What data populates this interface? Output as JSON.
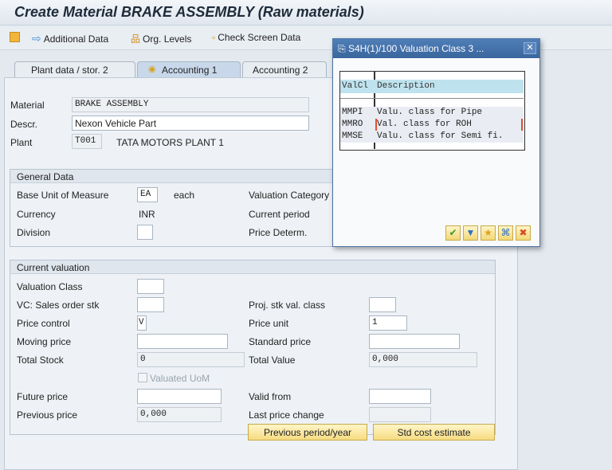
{
  "title": "Create Material BRAKE ASSEMBLY (Raw materials)",
  "toolbar": {
    "additional_data": "Additional Data",
    "org_levels": "Org. Levels",
    "check_screen": "Check Screen Data"
  },
  "tabs": [
    {
      "label": "Plant data / stor. 2"
    },
    {
      "label": "Accounting 1"
    },
    {
      "label": "Accounting 2"
    }
  ],
  "header": {
    "material_label": "Material",
    "material": "BRAKE ASSEMBLY",
    "descr_label": "Descr.",
    "descr": "Nexon Vehicle Part",
    "plant_label": "Plant",
    "plant": "T001",
    "plant_name": "TATA MOTORS PLANT 1"
  },
  "general": {
    "title": "General Data",
    "base_uom_label": "Base Unit of Measure",
    "base_uom": "EA",
    "base_uom_text": "each",
    "currency_label": "Currency",
    "currency": "INR",
    "division_label": "Division",
    "division": "",
    "val_cat_label": "Valuation Category",
    "cur_period_label": "Current period",
    "price_determ_label": "Price Determ."
  },
  "valuation": {
    "title": "Current valuation",
    "val_class_label": "Valuation Class",
    "val_class": "",
    "vc_sales_label": "VC: Sales order stk",
    "vc_sales": "",
    "proj_label": "Proj. stk val. class",
    "proj": "",
    "price_control_label": "Price control",
    "price_control": "V",
    "price_unit_label": "Price unit",
    "price_unit": "1",
    "moving_label": "Moving price",
    "moving": "",
    "standard_label": "Standard price",
    "standard": "",
    "total_stock_label": "Total Stock",
    "total_stock": "0",
    "total_value_label": "Total Value",
    "total_value": "0,000",
    "valuated_uom": "Valuated UoM",
    "future_label": "Future price",
    "future": "",
    "valid_from_label": "Valid from",
    "valid_from": "",
    "prev_price_label": "Previous price",
    "prev_price": "0,000",
    "last_change_label": "Last price change",
    "last_change": "",
    "prev_period_btn": "Previous period/year",
    "std_cost_btn": "Std cost estimate"
  },
  "dialog": {
    "title": "S4H(1)/100 Valuation Class 3 ...",
    "col1": "ValCl",
    "col2": "Description",
    "rows": [
      {
        "code": "MMPI",
        "desc": "Valu. class for Pipe"
      },
      {
        "code": "MMRO",
        "desc": "Val. class for ROH"
      },
      {
        "code": "MMSE",
        "desc": "Valu. class for Semi fi."
      }
    ]
  }
}
